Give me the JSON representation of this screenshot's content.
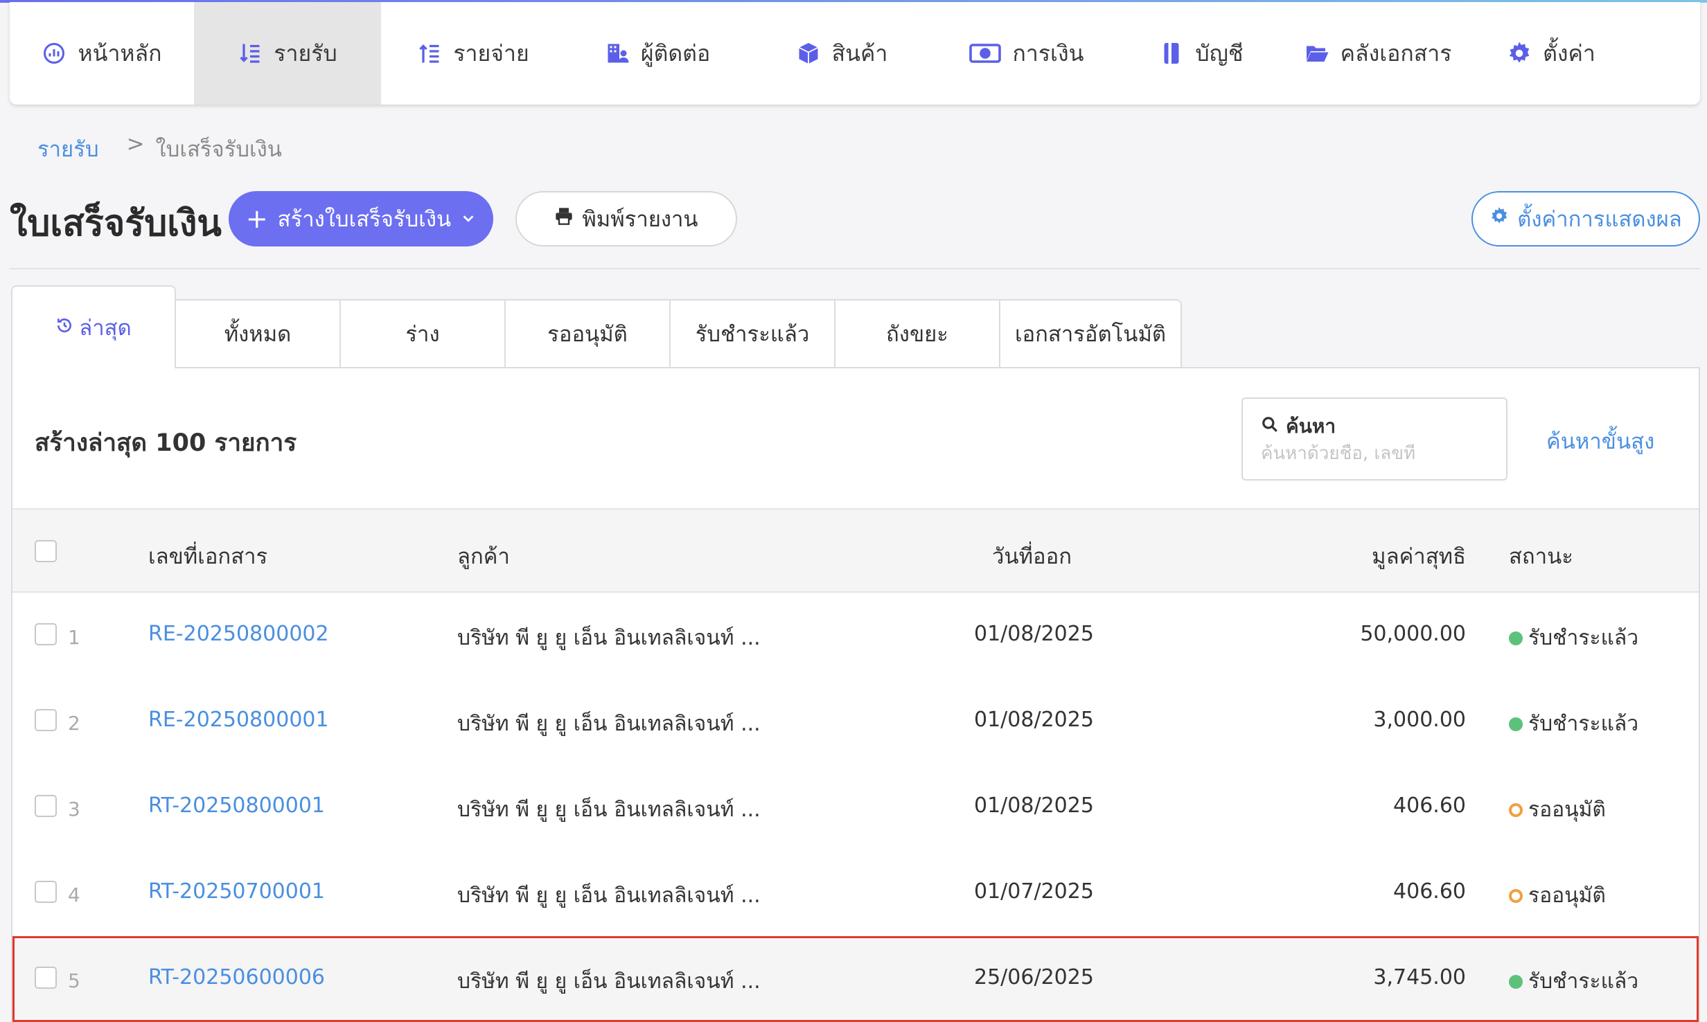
{
  "nav": {
    "items": [
      {
        "label": "หน้าหลัก",
        "icon": "dashboard-icon"
      },
      {
        "label": "รายรับ",
        "icon": "income-icon"
      },
      {
        "label": "รายจ่าย",
        "icon": "expense-icon"
      },
      {
        "label": "ผู้ติดต่อ",
        "icon": "contacts-icon"
      },
      {
        "label": "สินค้า",
        "icon": "box-icon"
      },
      {
        "label": "การเงิน",
        "icon": "money-icon"
      },
      {
        "label": "บัญชี",
        "icon": "book-icon"
      },
      {
        "label": "คลังเอกสาร",
        "icon": "folder-icon"
      },
      {
        "label": "ตั้งค่า",
        "icon": "gear-icon"
      }
    ],
    "active_index": 1
  },
  "breadcrumb": {
    "parent": "รายรับ",
    "separator": ">",
    "current": "ใบเสร็จรับเงิน"
  },
  "page": {
    "title": "ใบเสร็จรับเงิน",
    "create_button": "สร้างใบเสร็จรับเงิน",
    "print_button": "พิมพ์รายงาน",
    "settings_button": "ตั้งค่าการแสดงผล"
  },
  "tabs": [
    {
      "label": "ล่าสุด"
    },
    {
      "label": "ทั้งหมด"
    },
    {
      "label": "ร่าง"
    },
    {
      "label": "รออนุมัติ"
    },
    {
      "label": "รับชำระแล้ว"
    },
    {
      "label": "ถังขยะ"
    },
    {
      "label": "เอกสารอัตโนมัติ"
    }
  ],
  "list": {
    "title": "สร้างล่าสุด 100 รายการ",
    "search_label": "ค้นหา",
    "search_placeholder": "ค้นหาด้วยชื่อ, เลขที่",
    "advanced_search": "ค้นหาขั้นสูง"
  },
  "table": {
    "headers": {
      "doc_no": "เลขที่เอกสาร",
      "customer": "ลูกค้า",
      "date": "วันที่ออก",
      "amount": "มูลค่าสุทธิ",
      "status": "สถานะ"
    },
    "rows": [
      {
        "num": "1",
        "doc_no": "RE-20250800002",
        "customer": "บริษัท พี ยู ยู เอ็น อินเทลลิเจนท์ ...",
        "date": "01/08/2025",
        "amount": "50,000.00",
        "status": "รับชำระแล้ว",
        "status_type": "paid"
      },
      {
        "num": "2",
        "doc_no": "RE-20250800001",
        "customer": "บริษัท พี ยู ยู เอ็น อินเทลลิเจนท์ ...",
        "date": "01/08/2025",
        "amount": "3,000.00",
        "status": "รับชำระแล้ว",
        "status_type": "paid"
      },
      {
        "num": "3",
        "doc_no": "RT-20250800001",
        "customer": "บริษัท พี ยู ยู เอ็น อินเทลลิเจนท์ ...",
        "date": "01/08/2025",
        "amount": "406.60",
        "status": "รออนุมัติ",
        "status_type": "pending"
      },
      {
        "num": "4",
        "doc_no": "RT-20250700001",
        "customer": "บริษัท พี ยู ยู เอ็น อินเทลลิเจนท์ ...",
        "date": "01/07/2025",
        "amount": "406.60",
        "status": "รออนุมัติ",
        "status_type": "pending"
      },
      {
        "num": "5",
        "doc_no": "RT-20250600006",
        "customer": "บริษัท พี ยู ยู เอ็น อินเทลลิเจนท์ ...",
        "date": "25/06/2025",
        "amount": "3,745.00",
        "status": "รับชำระแล้ว",
        "status_type": "paid"
      }
    ],
    "highlighted_row": 4
  },
  "colors": {
    "accent": "#6c6ff0",
    "link": "#4a8fe0",
    "paid": "#5cc27a",
    "pending": "#f0a040",
    "highlight_border": "#e0392b"
  }
}
